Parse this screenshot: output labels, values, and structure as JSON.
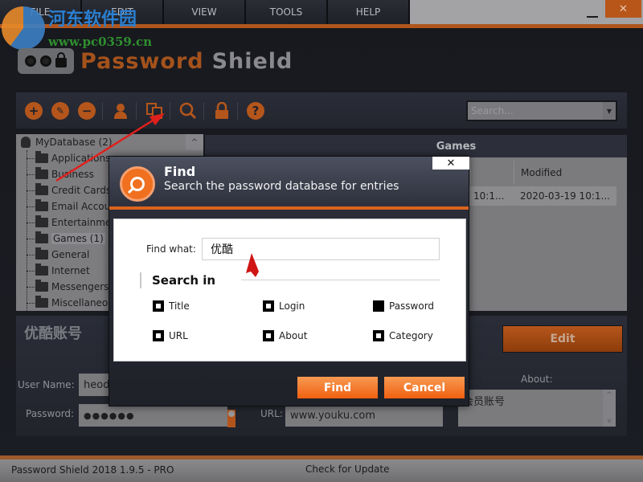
{
  "menu": {
    "items": [
      "FILE",
      "EDIT",
      "VIEW",
      "TOOLS",
      "HELP"
    ],
    "minimize_label": "_",
    "close_label": "✕"
  },
  "watermark": {
    "text": "河东软件园",
    "url": "www.pc0359.cn"
  },
  "logo": {
    "word1": "Password",
    "word2": "Shield"
  },
  "toolbar": {
    "icons": [
      "add-icon",
      "edit-icon",
      "remove-icon",
      "user-icon",
      "copy-icon",
      "search-icon",
      "lock-icon",
      "help-icon"
    ],
    "add_glyph": "+",
    "edit_glyph": "✎",
    "remove_glyph": "−",
    "help_glyph": "?",
    "search_placeholder": "Search...",
    "search_dropdown_glyph": "▼"
  },
  "tree": {
    "root": "MyDatabase (2)",
    "items": [
      "Applications",
      "Business",
      "Credit Cards",
      "Email Accounts",
      "Entertainment",
      "Games (1)",
      "General",
      "Internet",
      "Messengers",
      "Miscellaneous"
    ],
    "selected": "Games (1)",
    "scroll_up_glyph": "^"
  },
  "list": {
    "category_title": "Games",
    "columns": [
      "",
      "Modified"
    ],
    "rows": [
      {
        "created": "10:1...",
        "modified": "2020-03-19 10:1..."
      }
    ]
  },
  "detail": {
    "title": "优酷账号",
    "edit_label": "Edit",
    "username_label": "User Name:",
    "username_value": "heodr",
    "password_label": "Password:",
    "password_value": "●●●●●●",
    "url_label": "URL:",
    "url_value": "www.youku.com",
    "about_label": "About:",
    "about_value": "会员账号",
    "about_scroll_up": "^",
    "about_scroll_down": "v"
  },
  "status": {
    "version": "Password Shield 2018 1.9.5 - PRO",
    "update": "Check for Update"
  },
  "dialog": {
    "title": "Find",
    "subtitle": "Search the password database for entries",
    "close_label": "✕",
    "find_what_label": "Find what:",
    "find_what_value": "优酷",
    "search_in_label": "Search in",
    "options": [
      {
        "label": "Title",
        "checked": false
      },
      {
        "label": "Login",
        "checked": false
      },
      {
        "label": "Password",
        "checked": true
      },
      {
        "label": "URL",
        "checked": false
      },
      {
        "label": "About",
        "checked": false
      },
      {
        "label": "Category",
        "checked": false
      }
    ],
    "find_button": "Find",
    "cancel_button": "Cancel"
  },
  "colors": {
    "accent": "#b0561d",
    "dialog_button": "#f06010"
  }
}
